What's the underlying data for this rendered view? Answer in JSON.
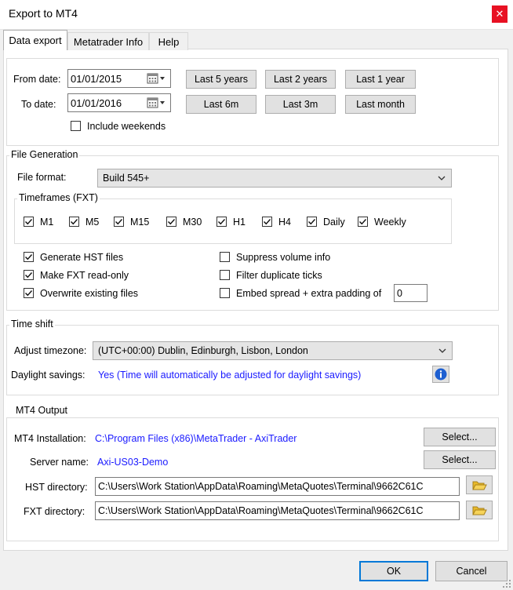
{
  "window": {
    "title": "Export to MT4",
    "close_glyph": "✕"
  },
  "tabs": [
    {
      "label": "Data export"
    },
    {
      "label": "Metatrader Info"
    },
    {
      "label": "Help"
    }
  ],
  "dates": {
    "from_label": "From date:",
    "from_value": "01/01/2015",
    "to_label": "To date:",
    "to_value": "01/01/2016",
    "include_weekends": "Include weekends",
    "presets": [
      "Last 5 years",
      "Last 2 years",
      "Last 1 year",
      "Last 6m",
      "Last 3m",
      "Last month"
    ]
  },
  "file_generation": {
    "title": "File Generation",
    "format_label": "File format:",
    "format_value": "Build 545+",
    "timeframes_title": "Timeframes (FXT)",
    "timeframes": [
      {
        "label": "M1",
        "checked": true
      },
      {
        "label": "M5",
        "checked": true
      },
      {
        "label": "M15",
        "checked": true
      },
      {
        "label": "M30",
        "checked": true
      },
      {
        "label": "H1",
        "checked": true
      },
      {
        "label": "H4",
        "checked": true
      },
      {
        "label": "Daily",
        "checked": true
      },
      {
        "label": "Weekly",
        "checked": true
      }
    ],
    "options_left": [
      {
        "label": "Generate HST files",
        "checked": true
      },
      {
        "label": "Make FXT read-only",
        "checked": true
      },
      {
        "label": "Overwrite existing files",
        "checked": true
      }
    ],
    "options_right": [
      {
        "label": "Suppress volume info",
        "checked": false
      },
      {
        "label": "Filter duplicate ticks",
        "checked": false
      },
      {
        "label": "Embed spread + extra padding of",
        "checked": false
      }
    ],
    "padding_value": "0"
  },
  "time_shift": {
    "title": "Time shift",
    "timezone_label": "Adjust timezone:",
    "timezone_value": "(UTC+00:00) Dublin, Edinburgh, Lisbon, London",
    "dst_label": "Daylight savings:",
    "dst_value": "Yes (Time will automatically be adjusted for daylight savings)"
  },
  "mt4_output": {
    "title": "MT4 Output",
    "installation_label": "MT4 Installation:",
    "installation_value": "C:\\Program Files (x86)\\MetaTrader - AxiTrader",
    "server_label": "Server name:",
    "server_value": "Axi-US03-Demo",
    "select_label": "Select...",
    "hst_label": "HST directory:",
    "hst_value": "C:\\Users\\Work Station\\AppData\\Roaming\\MetaQuotes\\Terminal\\9662C61C",
    "fxt_label": "FXT directory:",
    "fxt_value": "C:\\Users\\Work Station\\AppData\\Roaming\\MetaQuotes\\Terminal\\9662C61C"
  },
  "footer": {
    "ok": "OK",
    "cancel": "Cancel"
  },
  "colors": {
    "link_blue": "#1a1aff",
    "close_red": "#e81123",
    "focus_blue": "#0078d7"
  }
}
